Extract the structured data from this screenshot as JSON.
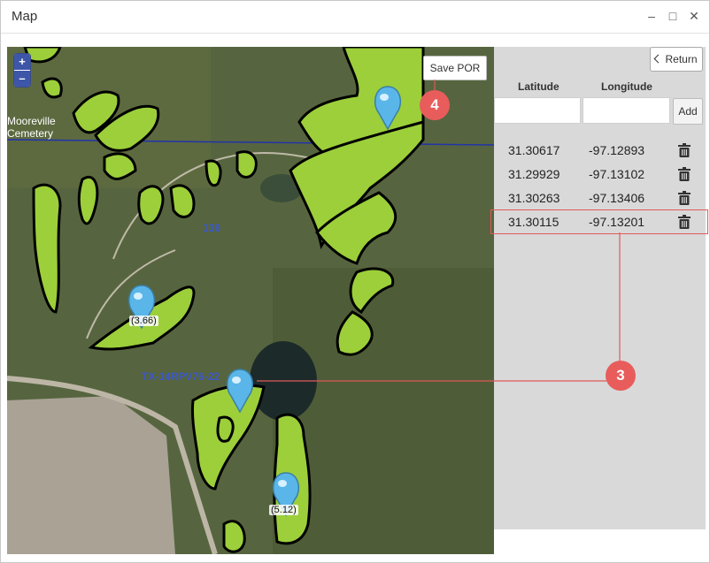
{
  "window": {
    "title": "Map",
    "controls": {
      "minimize": "–",
      "maximize": "□",
      "close": "✕"
    }
  },
  "map": {
    "zoom_in": "+",
    "zoom_out": "–",
    "save_button": "Save POR",
    "labels": {
      "cemetery_line1": "Mooreville",
      "cemetery_line2": "Cemetery",
      "road": "136",
      "parcel": "TX-14RPV76-22"
    },
    "pins": [
      {
        "label": "(3.66)"
      },
      {
        "label": "(5.12)"
      },
      {
        "label": ""
      },
      {
        "label": ""
      }
    ]
  },
  "panel": {
    "return_button": "Return",
    "headers": {
      "latitude": "Latitude",
      "longitude": "Longitude"
    },
    "inputs": {
      "latitude_value": "",
      "longitude_value": ""
    },
    "add_button": "Add",
    "rows": [
      {
        "lat": "31.30617",
        "lon": "-97.12893"
      },
      {
        "lat": "31.29929",
        "lon": "-97.13102"
      },
      {
        "lat": "31.30263",
        "lon": "-97.13406"
      },
      {
        "lat": "31.30115",
        "lon": "-97.13201"
      }
    ]
  },
  "callouts": {
    "save": "4",
    "row": "3"
  },
  "colors": {
    "callout": "#e85c5c",
    "field": "#9ccf3a",
    "outline": "#000000"
  }
}
